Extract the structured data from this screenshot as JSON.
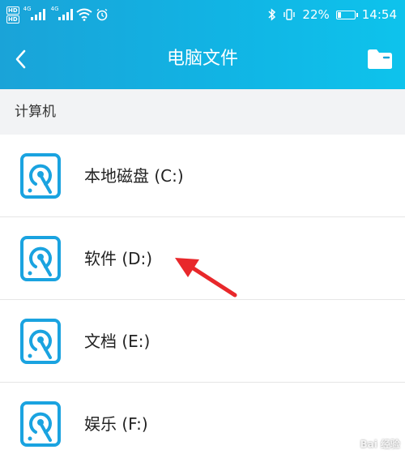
{
  "status_bar": {
    "hd_badge": "HD",
    "network": "4G",
    "battery": "22%",
    "battery_level": 0.22,
    "time": "14:54",
    "icons": [
      "hd-icon",
      "signal-icon",
      "wifi-icon",
      "alarm-icon",
      "bluetooth-icon",
      "vibrate-icon",
      "battery-icon"
    ]
  },
  "nav": {
    "title": "电脑文件",
    "back_icon": "chevron-left-icon",
    "action_icon": "folder-icon"
  },
  "section": {
    "label": "计算机"
  },
  "drives": [
    {
      "label": "本地磁盘 (C:)",
      "icon": "hard-disk-icon"
    },
    {
      "label": "软件 (D:)",
      "icon": "hard-disk-icon"
    },
    {
      "label": "文档 (E:)",
      "icon": "hard-disk-icon"
    },
    {
      "label": "娱乐 (F:)",
      "icon": "hard-disk-icon"
    }
  ],
  "colors": {
    "header_gradient_start": "#1aa3d8",
    "header_gradient_end": "#0ec3ec",
    "icon_blue": "#1aa3e0",
    "arrow_red": "#e8282b",
    "section_bg": "#f2f3f5"
  },
  "watermark": "Bai 经验"
}
